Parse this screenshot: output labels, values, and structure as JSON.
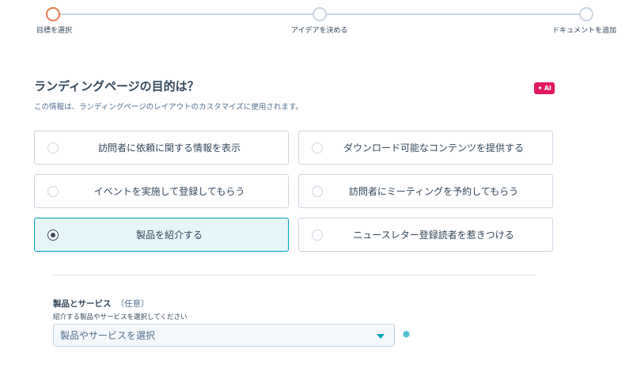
{
  "stepper": {
    "steps": [
      {
        "label": "目標を選択",
        "state": "active"
      },
      {
        "label": "アイデアを決める",
        "state": "upcoming"
      },
      {
        "label": "ドキュメントを追加",
        "state": "upcoming"
      }
    ]
  },
  "section": {
    "title": "ランディングページの目的は？",
    "subtitle": "この情報は、ランディングページのレイアウトのカスタマイズに使用されます。",
    "ai_badge": "AI"
  },
  "options": [
    {
      "label": "訪問者に依頼に関する情報を表示",
      "selected": false
    },
    {
      "label": "ダウンロード可能なコンテンツを提供する",
      "selected": false
    },
    {
      "label": "イベントを実施して登録してもらう",
      "selected": false
    },
    {
      "label": "訪問者にミーティングを予約してもらう",
      "selected": false
    },
    {
      "label": "製品を紹介する",
      "selected": true
    },
    {
      "label": "ニュースレター登録読者を惹きつける",
      "selected": false
    }
  ],
  "products_field": {
    "label": "製品とサービス",
    "optional": "（任意）",
    "help": "紹介する製品やサービスを選択してください",
    "placeholder": "製品やサービスを選択"
  },
  "colors": {
    "accent": "#00a4bd",
    "active_step": "#e97b4f",
    "ai_badge": "#e0185f",
    "text": "#33475b"
  }
}
